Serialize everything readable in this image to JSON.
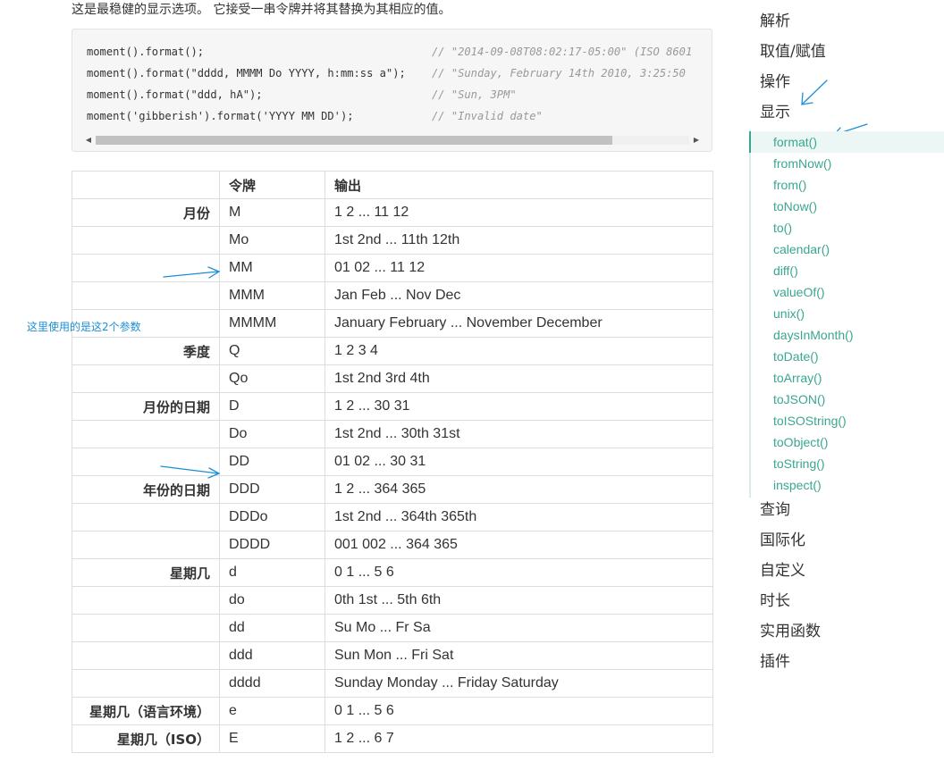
{
  "intro_text": "这是最稳健的显示选项。 它接受一串令牌并将其替换为其相应的值。",
  "code": {
    "lines": [
      {
        "call": "moment().format();",
        "comment": "// \"2014-09-08T08:02:17-05:00\" (ISO 8601"
      },
      {
        "call": "moment().format(\"dddd, MMMM Do YYYY, h:mm:ss a\");",
        "comment": "// \"Sunday, February 14th 2010, 3:25:50"
      },
      {
        "call": "moment().format(\"ddd, hA\");",
        "comment": "// \"Sun, 3PM\""
      },
      {
        "call": "moment('gibberish').format('YYYY MM DD');",
        "comment": "// \"Invalid date\""
      }
    ],
    "scroll_position": 0.0,
    "scroll_visible_fraction": 0.87
  },
  "table": {
    "headers": [
      "",
      "令牌",
      "输出"
    ],
    "rows": [
      {
        "cat": "月份",
        "token": "M",
        "output": "1 2 ... 11 12"
      },
      {
        "cat": "",
        "token": "Mo",
        "output": "1st 2nd ... 11th 12th"
      },
      {
        "cat": "",
        "token": "MM",
        "output": "01 02 ... 11 12"
      },
      {
        "cat": "",
        "token": "MMM",
        "output": "Jan Feb ... Nov Dec"
      },
      {
        "cat": "",
        "token": "MMMM",
        "output": "January February ... November December"
      },
      {
        "cat": "季度",
        "token": "Q",
        "output": "1 2 3 4"
      },
      {
        "cat": "",
        "token": "Qo",
        "output": "1st 2nd 3rd 4th"
      },
      {
        "cat": "月份的日期",
        "token": "D",
        "output": "1 2 ... 30 31"
      },
      {
        "cat": "",
        "token": "Do",
        "output": "1st 2nd ... 30th 31st"
      },
      {
        "cat": "",
        "token": "DD",
        "output": "01 02 ... 30 31"
      },
      {
        "cat": "年份的日期",
        "token": "DDD",
        "output": "1 2 ... 364 365"
      },
      {
        "cat": "",
        "token": "DDDo",
        "output": "1st 2nd ... 364th 365th"
      },
      {
        "cat": "",
        "token": "DDDD",
        "output": "001 002 ... 364 365"
      },
      {
        "cat": "星期几",
        "token": "d",
        "output": "0 1 ... 5 6"
      },
      {
        "cat": "",
        "token": "do",
        "output": "0th 1st ... 5th 6th"
      },
      {
        "cat": "",
        "token": "dd",
        "output": "Su Mo ... Fr Sa"
      },
      {
        "cat": "",
        "token": "ddd",
        "output": "Sun Mon ... Fri Sat"
      },
      {
        "cat": "",
        "token": "dddd",
        "output": "Sunday Monday ... Friday Saturday"
      },
      {
        "cat": "星期几（语言环境）",
        "token": "e",
        "output": "0 1 ... 5 6"
      },
      {
        "cat": "星期几（ISO）",
        "token": "E",
        "output": "1 2 ... 6 7"
      }
    ]
  },
  "annotation_note": "这里使用的是这2个参数",
  "annotation_color": "#1c8fd6",
  "sidebar": {
    "sections_before": [
      "解析",
      "取值/赋值",
      "操作",
      "显示"
    ],
    "display_items": [
      "format()",
      "fromNow()",
      "from()",
      "toNow()",
      "to()",
      "calendar()",
      "diff()",
      "valueOf()",
      "unix()",
      "daysInMonth()",
      "toDate()",
      "toArray()",
      "toJSON()",
      "toISOString()",
      "toObject()",
      "toString()",
      "inspect()"
    ],
    "active_item": "format()",
    "sections_after": [
      "查询",
      "国际化",
      "自定义",
      "时长",
      "实用函数",
      "插件"
    ]
  },
  "colors": {
    "accent": "#3aa691",
    "text": "#333333",
    "comment": "#999999",
    "border": "#dddddd"
  }
}
